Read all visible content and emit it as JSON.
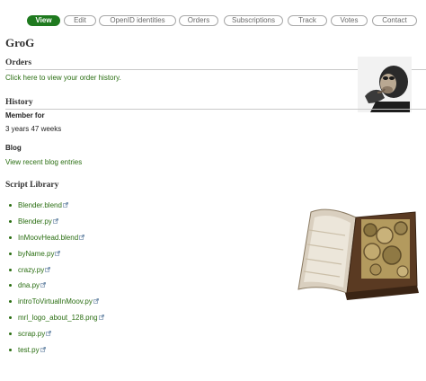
{
  "tabs": [
    {
      "label": "View",
      "active": true
    },
    {
      "label": "Edit"
    },
    {
      "label": "OpenID identities"
    },
    {
      "label": "Orders"
    },
    {
      "label": "Subscriptions"
    },
    {
      "label": "Track"
    },
    {
      "label": "Votes"
    },
    {
      "label": "Contact"
    }
  ],
  "profile": {
    "name": "GroG",
    "avatar_icon": "chimpanzee-thinker-photo"
  },
  "orders": {
    "heading": "Orders",
    "link": "Click here to view your order history."
  },
  "history": {
    "heading": "History",
    "member_for_label": "Member for",
    "member_for_value": "3 years 47 weeks"
  },
  "blog": {
    "heading": "Blog",
    "link": "View recent blog entries"
  },
  "scripts": {
    "heading": "Script Library",
    "items": [
      "Blender.blend",
      "Blender.py",
      "InMoovHead.blend",
      "byName.py",
      "crazy.py",
      "dna.py",
      "introToVirtualInMoov.py",
      "mrl_logo_about_128.png",
      "scrap.py",
      "test.py"
    ],
    "image_icon": "open-book-of-gears-image"
  },
  "colors": {
    "accent": "#1f7a1f",
    "link": "#2a6e12"
  }
}
